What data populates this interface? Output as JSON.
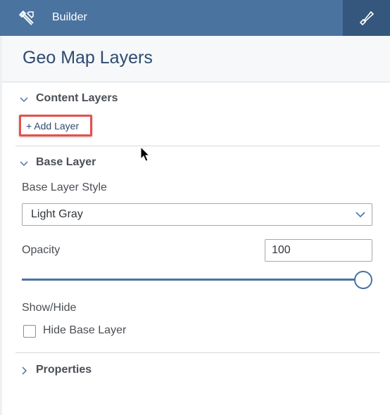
{
  "topbar": {
    "tools_icon": "wrench-screwdriver-icon",
    "title": "Builder",
    "format_icon": "paintbrush-icon"
  },
  "panel": {
    "title": "Geo Map Layers"
  },
  "content_layers": {
    "title": "Content Layers",
    "expanded": true,
    "add_layer_label": "+ Add Layer"
  },
  "base_layer": {
    "title": "Base Layer",
    "expanded": true,
    "style_label": "Base Layer Style",
    "style_value": "Light Gray",
    "opacity_label": "Opacity",
    "opacity_value": "100",
    "opacity_slider_percent": 100,
    "show_hide_label": "Show/Hide",
    "hide_checkbox_label": "Hide Base Layer",
    "hide_checked": false
  },
  "properties": {
    "title": "Properties",
    "expanded": false
  },
  "colors": {
    "topbar": "#4a73a0",
    "topbar_active": "#35577e",
    "highlight": "#e8504a"
  }
}
